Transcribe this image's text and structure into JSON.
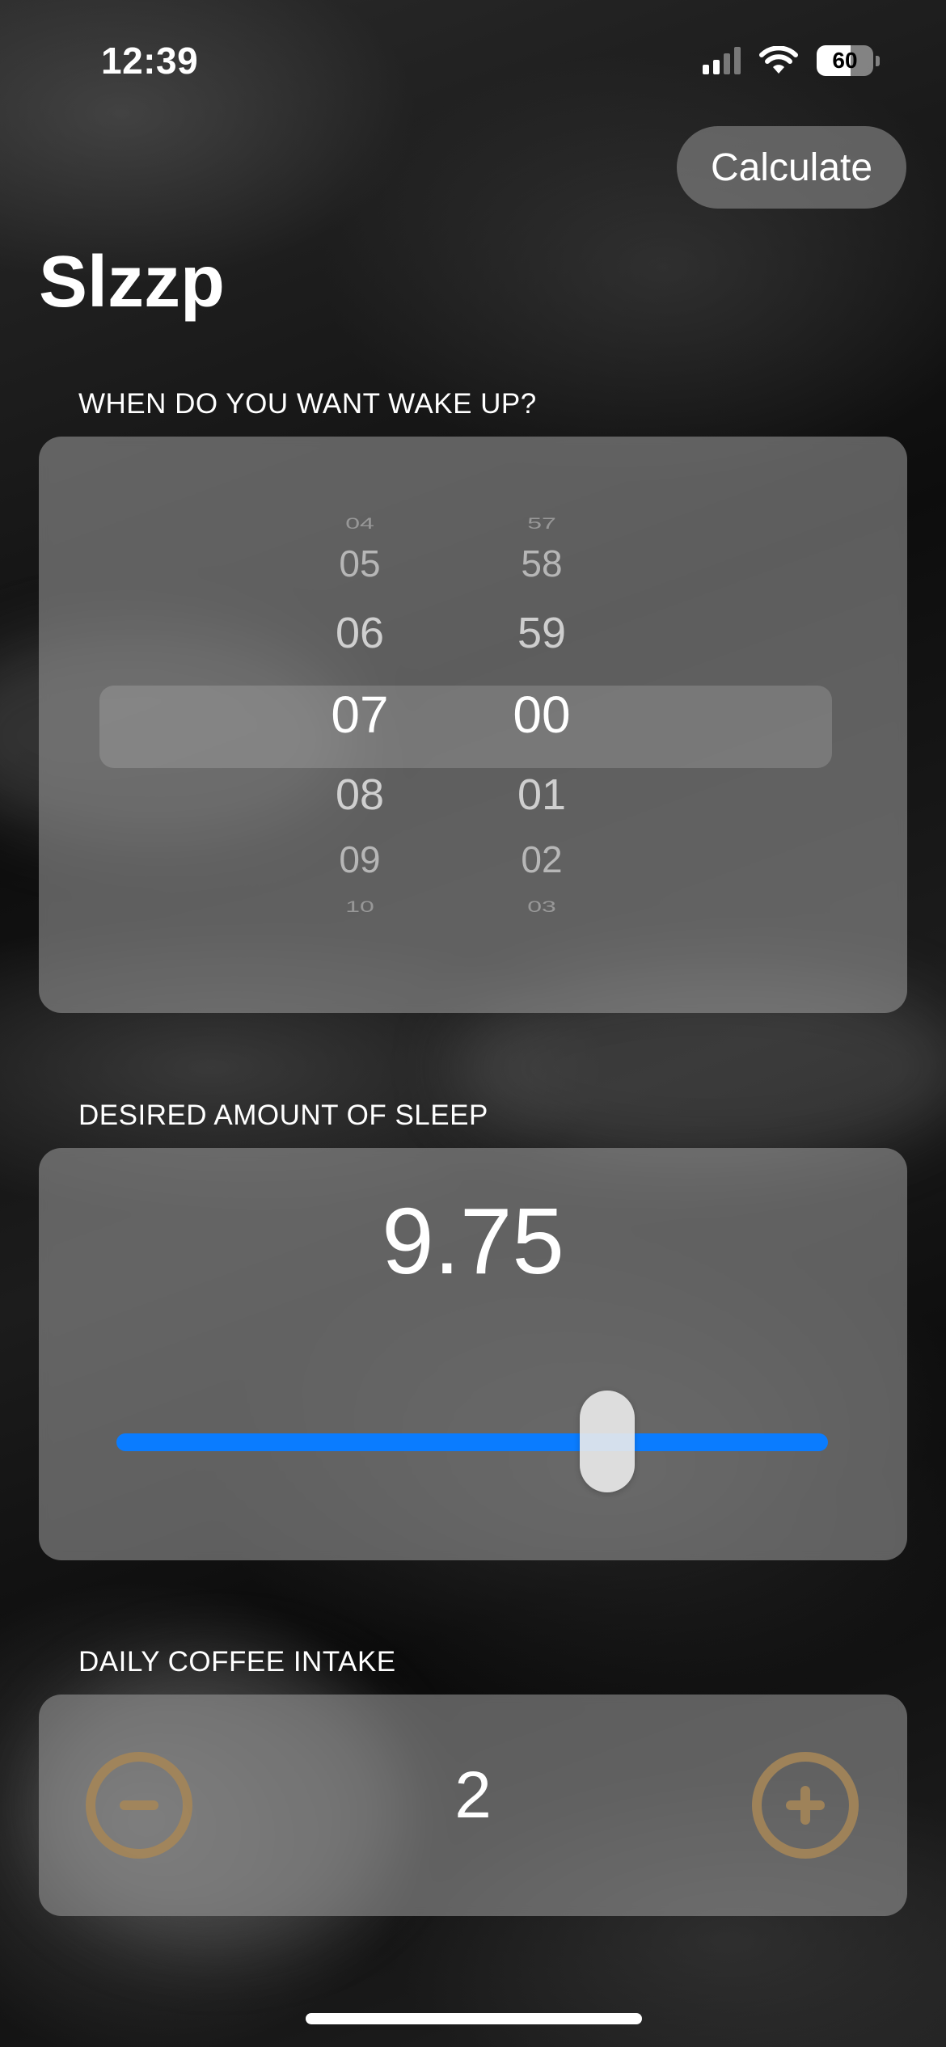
{
  "status_bar": {
    "time": "12:39",
    "battery_level": "60",
    "battery_fraction": 0.6,
    "signal_bars_active": 2,
    "signal_bars_total": 4
  },
  "toolbar": {
    "calculate_label": "Calculate"
  },
  "app": {
    "title": "Slzzp"
  },
  "wake_up": {
    "label": "WHEN DO YOU WANT WAKE UP?",
    "hours": [
      "04",
      "05",
      "06",
      "07",
      "08",
      "09",
      "10"
    ],
    "minutes": [
      "57",
      "58",
      "59",
      "00",
      "01",
      "02",
      "03"
    ],
    "selected_hour": "07",
    "selected_minute": "00"
  },
  "sleep": {
    "label": "DESIRED AMOUNT OF SLEEP",
    "value": "9.75",
    "slider_fraction": 0.69
  },
  "coffee": {
    "label": "DAILY COFFEE INTAKE",
    "count": "2"
  },
  "colors": {
    "accent_blue": "#0a7cff",
    "stepper_gold": "#a58659"
  },
  "icons": {
    "minus": "minus-circle-icon",
    "plus": "plus-circle-icon",
    "wifi": "wifi-icon",
    "signal": "cellular-signal-icon",
    "battery": "battery-icon"
  }
}
